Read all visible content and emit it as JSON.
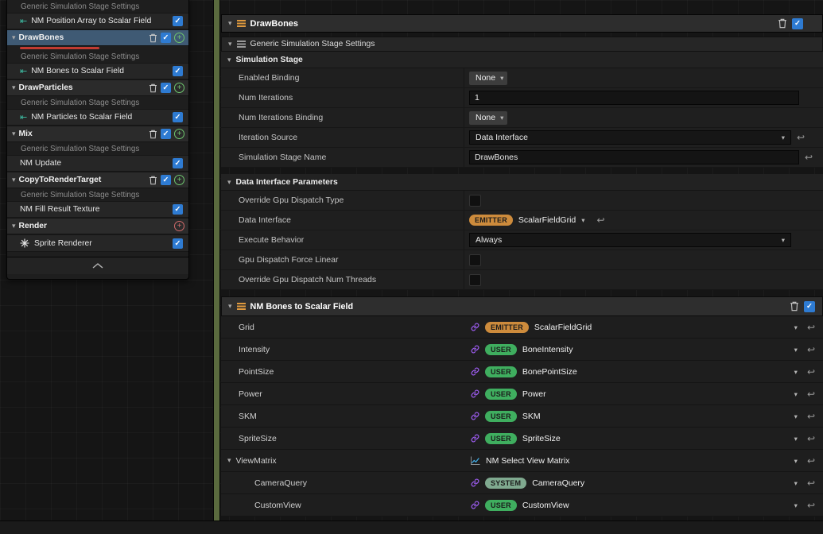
{
  "glyphs": {
    "check": "✓",
    "chevron_down": "▾",
    "plus": "+",
    "reset": "↩",
    "scratch_module": "⇤"
  },
  "colors": {
    "accent_strip": "#5a6a3e",
    "selection": "#3f5a74",
    "checkbox_checked": "#2e7bd2",
    "emitter_badge": "#cd8b3c",
    "user_badge": "#3fae5f",
    "system_badge": "#7fa98f",
    "link_icon": "#9d5cf0",
    "error_underline": "#c23b32"
  },
  "stack": {
    "rows": [
      {
        "label": "Generic Simulation Stage Settings"
      },
      {
        "label": "NM Position Array to Scalar Field"
      },
      {
        "label": "DrawBones"
      },
      {
        "label": "Generic Simulation Stage Settings"
      },
      {
        "label": "NM Bones to Scalar Field"
      },
      {
        "label": "DrawParticles"
      },
      {
        "label": "Generic Simulation Stage Settings"
      },
      {
        "label": "NM Particles to Scalar Field"
      },
      {
        "label": "Mix"
      },
      {
        "label": "Generic Simulation Stage Settings"
      },
      {
        "label": "NM Update"
      },
      {
        "label": "CopyToRenderTarget"
      },
      {
        "label": "Generic Simulation Stage Settings"
      },
      {
        "label": "NM Fill Result Texture"
      },
      {
        "label": "Render"
      },
      {
        "label": "Sprite Renderer"
      }
    ]
  },
  "details": {
    "title": "DrawBones",
    "generic_settings_header": "Generic Simulation Stage Settings",
    "simulation_stage_header": "Simulation Stage",
    "data_interface_params_header": "Data Interface Parameters",
    "module_header": "NM Bones to Scalar Field",
    "rows": {
      "enabled_binding": {
        "label": "Enabled Binding",
        "value": "None"
      },
      "num_iterations": {
        "label": "Num Iterations",
        "value": "1"
      },
      "num_iterations_binding": {
        "label": "Num Iterations Binding",
        "value": "None"
      },
      "iteration_source": {
        "label": "Iteration Source",
        "value": "Data Interface"
      },
      "simulation_stage_name": {
        "label": "Simulation Stage Name",
        "value": "DrawBones"
      },
      "override_gpu_dispatch_type": {
        "label": "Override Gpu Dispatch Type"
      },
      "data_interface": {
        "label": "Data Interface",
        "namespace": "EMITTER",
        "value": "ScalarFieldGrid"
      },
      "execute_behavior": {
        "label": "Execute Behavior",
        "value": "Always"
      },
      "gpu_dispatch_force_linear": {
        "label": "Gpu Dispatch Force Linear"
      },
      "override_gpu_dispatch_num_threads": {
        "label": "Override Gpu Dispatch Num Threads"
      }
    },
    "params": [
      {
        "label": "Grid",
        "namespace": "EMITTER",
        "value": "ScalarFieldGrid"
      },
      {
        "label": "Intensity",
        "namespace": "USER",
        "value": "BoneIntensity"
      },
      {
        "label": "PointSize",
        "namespace": "USER",
        "value": "BonePointSize"
      },
      {
        "label": "Power",
        "namespace": "USER",
        "value": "Power"
      },
      {
        "label": "SKM",
        "namespace": "USER",
        "value": "SKM"
      },
      {
        "label": "SpriteSize",
        "namespace": "USER",
        "value": "SpriteSize"
      },
      {
        "label": "ViewMatrix",
        "value": "NM Select View Matrix"
      },
      {
        "label": "CameraQuery",
        "namespace": "SYSTEM",
        "value": "CameraQuery"
      },
      {
        "label": "CustomView",
        "namespace": "USER",
        "value": "CustomView"
      }
    ]
  }
}
